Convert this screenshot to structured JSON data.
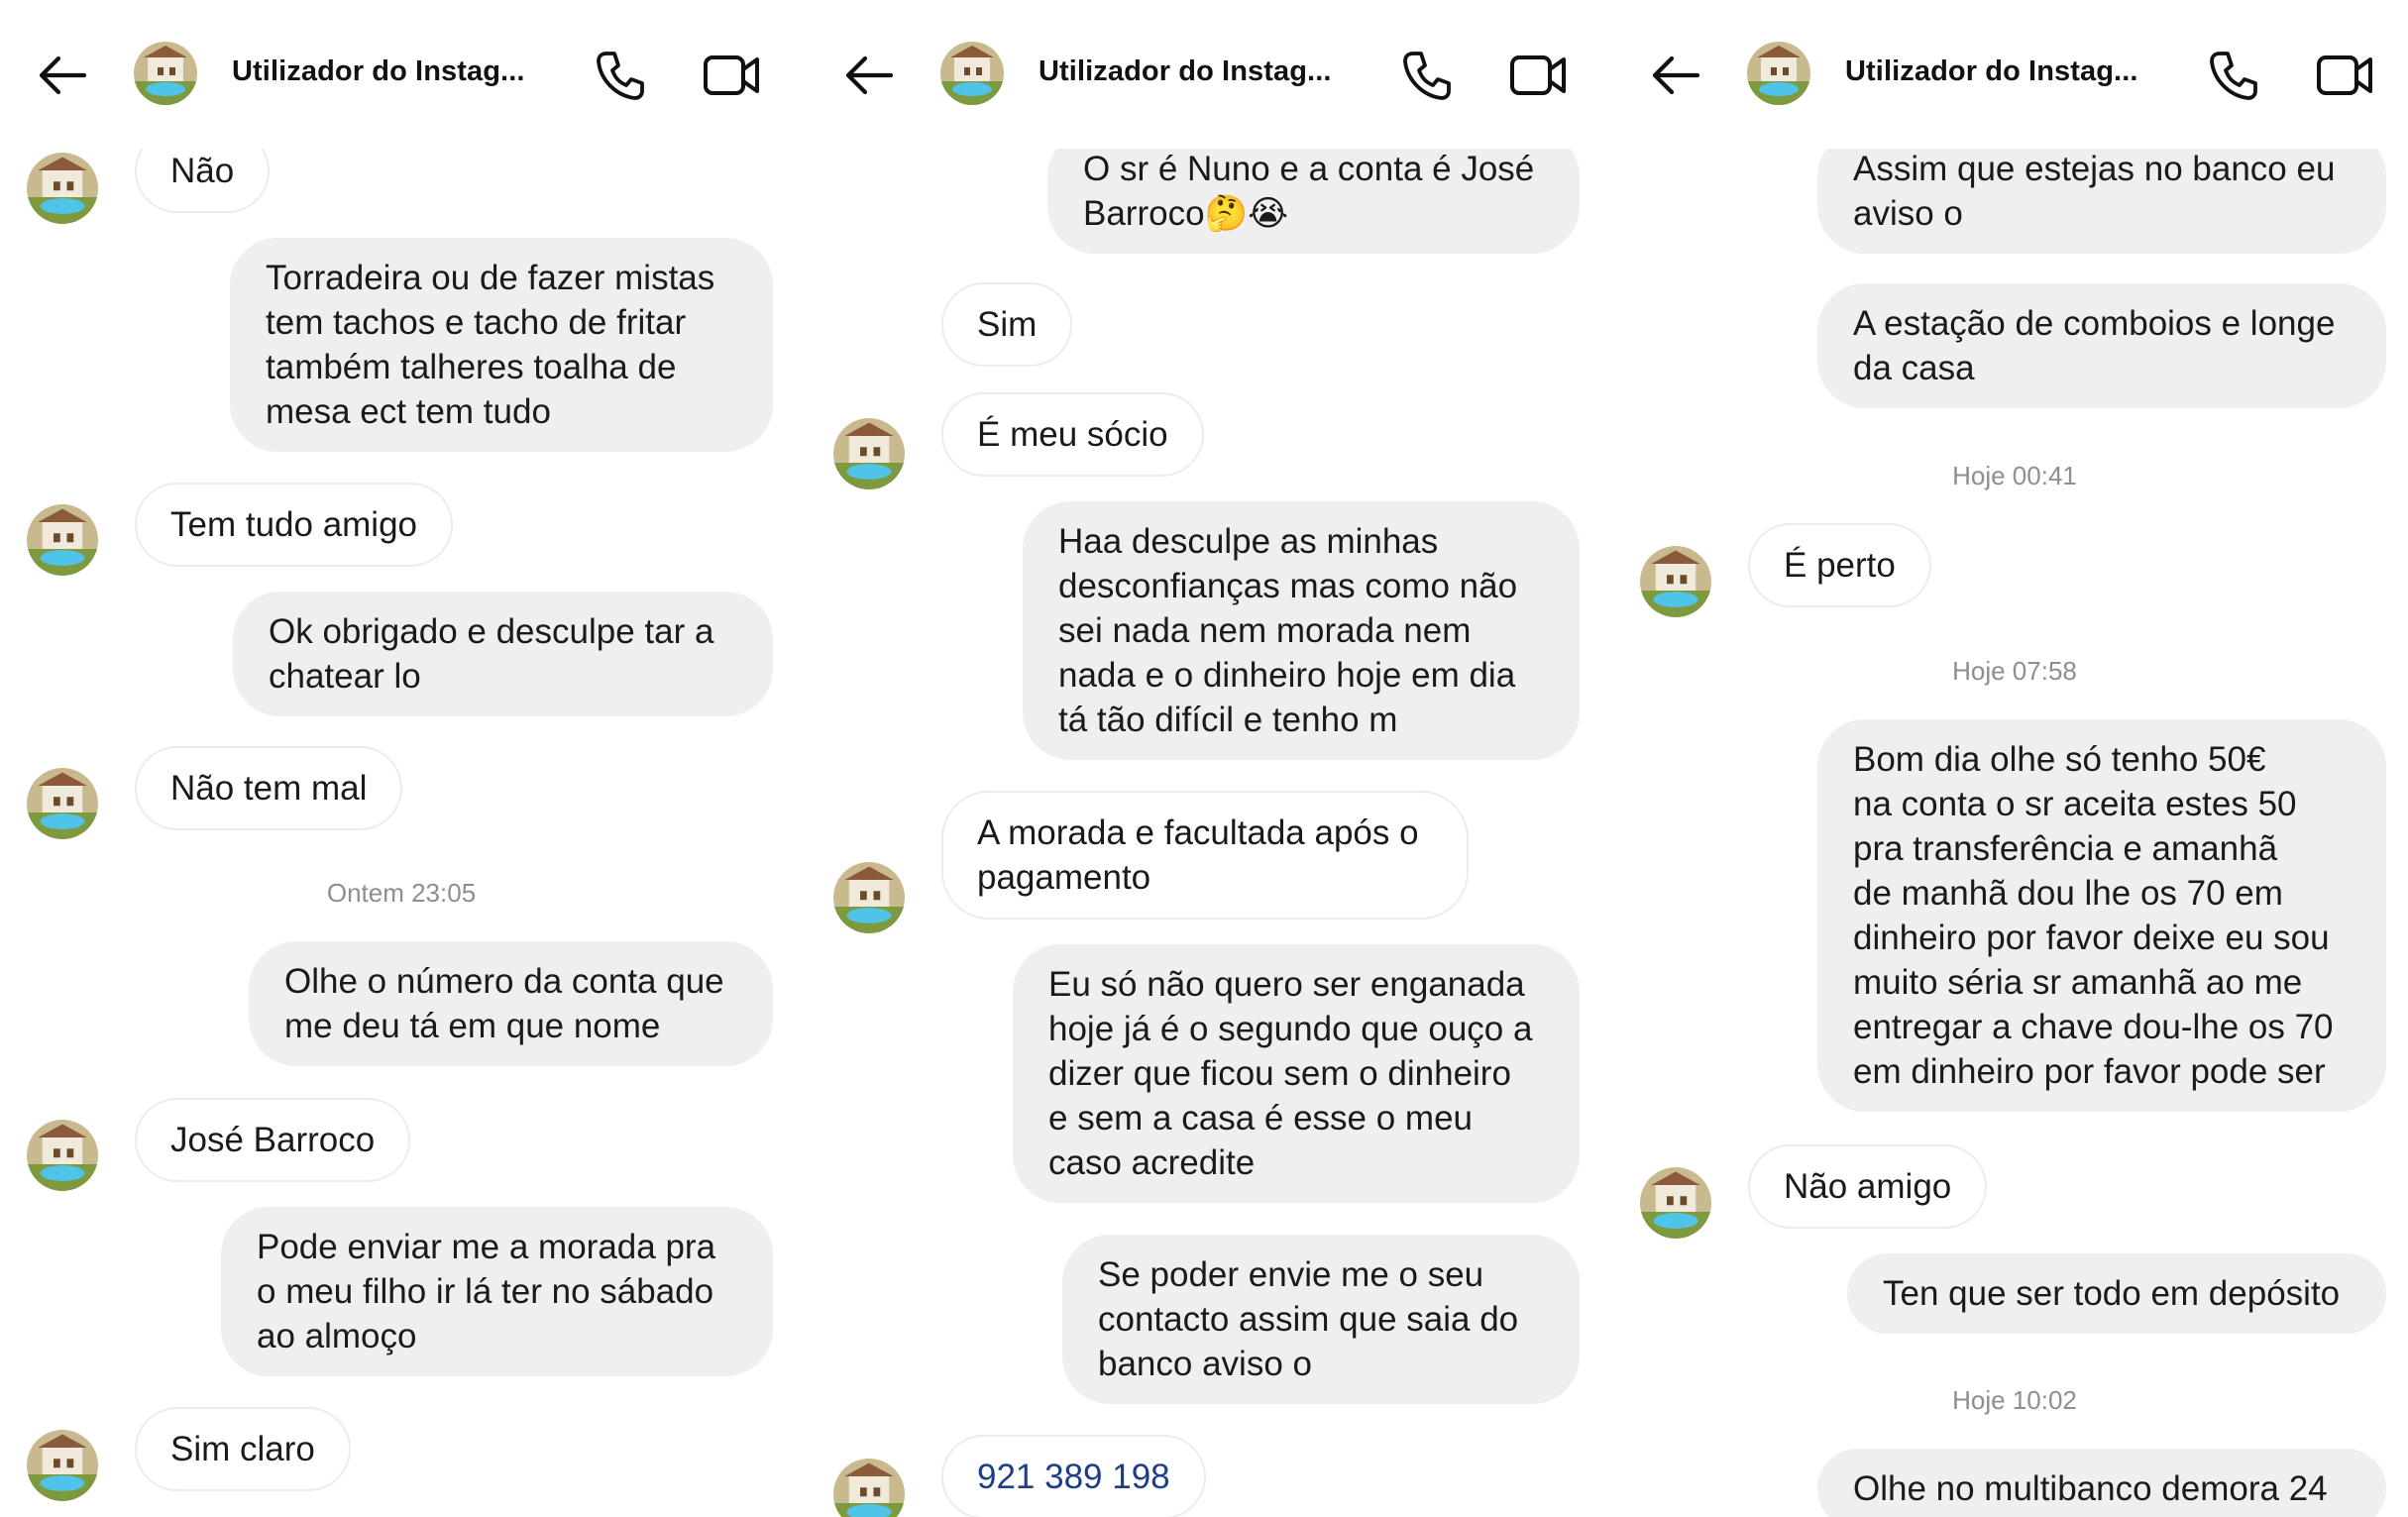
{
  "colors": {
    "outgoing_bubble": "#efefef",
    "incoming_border": "#ececec",
    "timestamp": "#8e8e8e",
    "phone_number_text": "#1f3c88"
  },
  "icons": {
    "back": "arrow-left-icon",
    "call": "phone-icon",
    "video": "video-camera-icon",
    "avatar": "house-pool-avatar"
  },
  "panels": [
    {
      "header": {
        "title": "Utilizador do Instag..."
      },
      "messages": [
        {
          "type": "in",
          "text": "Não"
        },
        {
          "type": "out",
          "text": "Torradeira ou de fazer mistas\ntem tachos e tacho de fritar\ntambém talheres toalha de\nmesa  ect tem tudo"
        },
        {
          "type": "in",
          "text": "Tem tudo amigo"
        },
        {
          "type": "out",
          "text": "Ok obrigado e  desculpe tar a\nchatear lo"
        },
        {
          "type": "in",
          "text": "Não tem mal"
        },
        {
          "type": "timestamp",
          "text": "Ontem 23:05"
        },
        {
          "type": "out",
          "text": "Olhe o número da conta que\nme deu tá em que nome"
        },
        {
          "type": "in",
          "text": "José Barroco"
        },
        {
          "type": "out",
          "text": "Pode enviar me a  morada pra\no meu filho ir lá ter no sábado\nao almoço"
        },
        {
          "type": "in",
          "text": "Sim claro"
        }
      ]
    },
    {
      "header": {
        "title": "Utilizador do Instag..."
      },
      "messages": [
        {
          "type": "out",
          "text": "O sr é Nuno e a conta é José\nBarroco🤔😭"
        },
        {
          "type": "in",
          "text": "Sim"
        },
        {
          "type": "in",
          "text": "É meu sócio"
        },
        {
          "type": "out",
          "text": "Haa desculpe as minhas\ndesconfianças mas como não\nsei nada nem morada nem\nnada  e o dinheiro hoje em dia\ntá tão difícil e tenho m"
        },
        {
          "type": "in",
          "text": "A morada e facultada após o\npagamento"
        },
        {
          "type": "out",
          "text": "Eu só não quero ser enganada\nhoje já é o segundo que ouço a\ndizer que ficou sem o dinheiro\ne sem a casa é esse o meu\ncaso acredite"
        },
        {
          "type": "out",
          "text": "Se poder envie me o seu\ncontacto assim que saia do\nbanco aviso o"
        },
        {
          "type": "in",
          "text": "921 389 198"
        }
      ]
    },
    {
      "header": {
        "title": "Utilizador do Instag..."
      },
      "messages": [
        {
          "type": "out",
          "text": "Assim que estejas no banco eu\naviso o"
        },
        {
          "type": "out",
          "text": "A estação de comboios e longe\nda casa"
        },
        {
          "type": "timestamp",
          "text": "Hoje 00:41"
        },
        {
          "type": "in",
          "text": "É perto"
        },
        {
          "type": "timestamp",
          "text": "Hoje 07:58"
        },
        {
          "type": "out",
          "text": "Bom dia olhe só tenho 50€\nna conta o sr aceita estes 50\npra transferência e amanhã\nde manhã dou lhe os 70 em\ndinheiro por favor deixe  eu sou\nmuito séria sr amanhã ao me\nentregar a chave dou-lhe os 70\nem dinheiro por favor pode ser"
        },
        {
          "type": "in",
          "text": "Não amigo"
        },
        {
          "type": "out",
          "text": "Ten que ser todo em depósito"
        },
        {
          "type": "timestamp",
          "text": "Hoje 10:02"
        },
        {
          "type": "out",
          "text": "Olhe  no multibanco demora 24"
        }
      ]
    }
  ]
}
